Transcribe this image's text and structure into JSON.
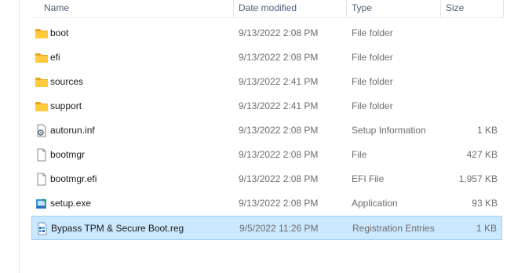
{
  "columns": {
    "name": "Name",
    "date": "Date modified",
    "type": "Type",
    "size": "Size"
  },
  "files": [
    {
      "name": "boot",
      "date": "9/13/2022 2:08 PM",
      "type": "File folder",
      "size": "",
      "icon": "folder-icon"
    },
    {
      "name": "efi",
      "date": "9/13/2022 2:08 PM",
      "type": "File folder",
      "size": "",
      "icon": "folder-icon"
    },
    {
      "name": "sources",
      "date": "9/13/2022 2:41 PM",
      "type": "File folder",
      "size": "",
      "icon": "folder-icon"
    },
    {
      "name": "support",
      "date": "9/13/2022 2:41 PM",
      "type": "File folder",
      "size": "",
      "icon": "folder-icon"
    },
    {
      "name": "autorun.inf",
      "date": "9/13/2022 2:08 PM",
      "type": "Setup Information",
      "size": "1 KB",
      "icon": "setup-info-file-icon"
    },
    {
      "name": "bootmgr",
      "date": "9/13/2022 2:08 PM",
      "type": "File",
      "size": "427 KB",
      "icon": "blank-file-icon"
    },
    {
      "name": "bootmgr.efi",
      "date": "9/13/2022 2:08 PM",
      "type": "EFI File",
      "size": "1,957 KB",
      "icon": "blank-file-icon"
    },
    {
      "name": "setup.exe",
      "date": "9/13/2022 2:08 PM",
      "type": "Application",
      "size": "93 KB",
      "icon": "setup-exe-icon"
    },
    {
      "name": "Bypass TPM & Secure Boot.reg",
      "date": "9/5/2022 11:26 PM",
      "type": "Registration Entries",
      "size": "1 KB",
      "icon": "registry-file-icon",
      "selected": true
    }
  ]
}
